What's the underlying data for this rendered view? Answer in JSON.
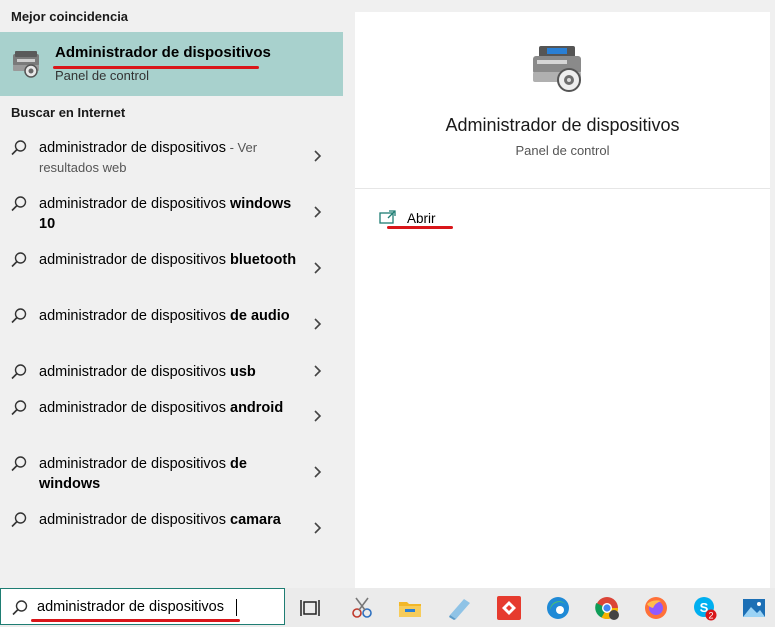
{
  "left": {
    "best_match_header": "Mejor coincidencia",
    "best_match": {
      "title": "Administrador de dispositivos",
      "subtitle": "Panel de control",
      "icon": "device-manager-icon"
    },
    "web_header": "Buscar en Internet",
    "results": [
      {
        "plain": "administrador de dispositivos",
        "bold": "",
        "muted": " - Ver resultados web"
      },
      {
        "plain": "administrador de dispositivos ",
        "bold": "windows 10",
        "muted": ""
      },
      {
        "plain": "administrador de dispositivos ",
        "bold": "bluetooth",
        "muted": ""
      },
      {
        "plain": "administrador de dispositivos ",
        "bold": "de audio",
        "muted": ""
      },
      {
        "plain": "administrador de dispositivos ",
        "bold": "usb",
        "muted": ""
      },
      {
        "plain": "administrador de dispositivos ",
        "bold": "android",
        "muted": ""
      },
      {
        "plain": "administrador de dispositivos ",
        "bold": "de windows",
        "muted": ""
      },
      {
        "plain": "administrador de dispositivos ",
        "bold": "camara",
        "muted": ""
      }
    ]
  },
  "right": {
    "title": "Administrador de dispositivos",
    "subtitle": "Panel de control",
    "action_label": "Abrir",
    "icon": "device-manager-icon"
  },
  "taskbar": {
    "search_value": "administrador de dispositivos",
    "apps": [
      {
        "name": "task-view-icon"
      },
      {
        "name": "snipping-tool-icon"
      },
      {
        "name": "file-explorer-icon"
      },
      {
        "name": "notepad-app-icon"
      },
      {
        "name": "anydesk-icon"
      },
      {
        "name": "edge-icon"
      },
      {
        "name": "chrome-icon"
      },
      {
        "name": "firefox-icon"
      },
      {
        "name": "skype-icon",
        "badge": "2"
      },
      {
        "name": "photos-icon"
      }
    ]
  },
  "colors": {
    "highlight": "#a8d1cd",
    "annotation_red": "#d9161a",
    "accent_teal": "#1e7d73"
  }
}
